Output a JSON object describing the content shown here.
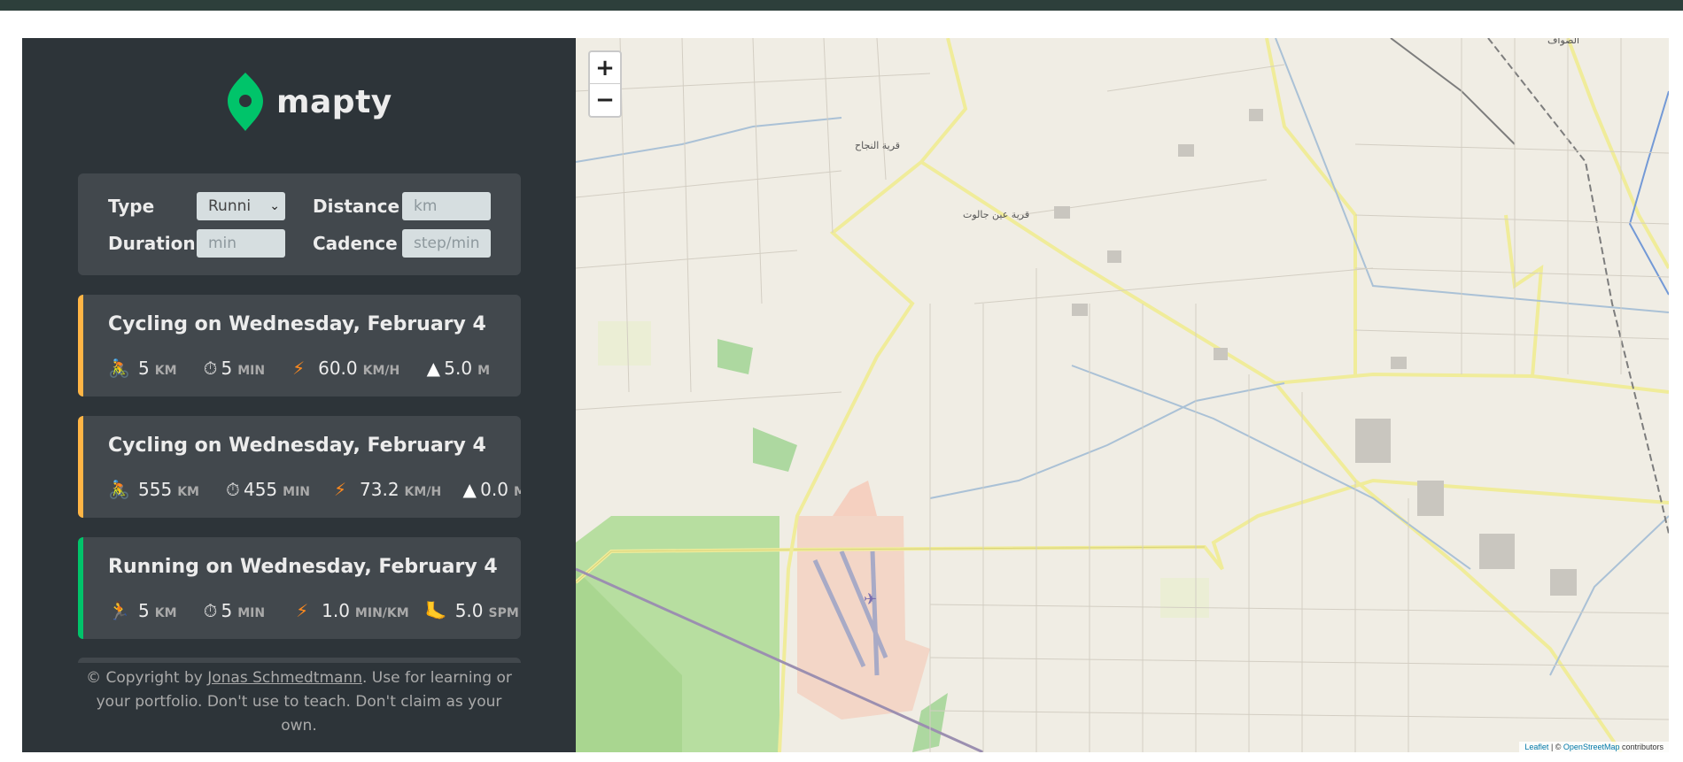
{
  "app": {
    "name": "mapty"
  },
  "form": {
    "type_label": "Type",
    "type_value": "Runni",
    "distance_label": "Distance",
    "distance_placeholder": "km",
    "duration_label": "Duration",
    "duration_placeholder": "min",
    "cadence_label": "Cadence",
    "cadence_placeholder": "step/min"
  },
  "workouts": [
    {
      "title": "Cycling on Wednesday, February 4",
      "type": "cycling",
      "accent": "#ffb545",
      "stats": [
        {
          "icon": "cyclist-icon",
          "value": "5",
          "unit": "km"
        },
        {
          "icon": "stopwatch-icon",
          "value": "5",
          "unit": "min"
        },
        {
          "icon": "lightning-icon",
          "value": "60.0",
          "unit": "km/h"
        },
        {
          "icon": "mountain-icon",
          "value": "5.0",
          "unit": "m"
        }
      ]
    },
    {
      "title": "Cycling on Wednesday, February 4",
      "type": "cycling",
      "accent": "#ffb545",
      "stats": [
        {
          "icon": "cyclist-icon",
          "value": "555",
          "unit": "km"
        },
        {
          "icon": "stopwatch-icon",
          "value": "455",
          "unit": "min"
        },
        {
          "icon": "lightning-icon",
          "value": "73.2",
          "unit": "km/h"
        },
        {
          "icon": "mountain-icon",
          "value": "0.0",
          "unit": "m"
        }
      ]
    },
    {
      "title": "Running on Wednesday, February 4",
      "type": "running",
      "accent": "#00c46a",
      "stats": [
        {
          "icon": "runner-icon",
          "value": "5",
          "unit": "km"
        },
        {
          "icon": "stopwatch-icon",
          "value": "5",
          "unit": "min"
        },
        {
          "icon": "lightning-icon",
          "value": "1.0",
          "unit": "min/km"
        },
        {
          "icon": "footprint-icon",
          "value": "5.0",
          "unit": "spm"
        }
      ]
    }
  ],
  "footer": {
    "prefix": "© Copyright by ",
    "author": "Jonas Schmedtmann",
    "suffix": ". Use for learning or your portfolio. Don't use to teach. Don't claim as your own."
  },
  "map": {
    "zoom_in": "+",
    "zoom_out": "−",
    "attribution_leaflet": "Leaflet",
    "attribution_sep": " | © ",
    "attribution_osm": "OpenStreetMap",
    "attribution_suffix": " contributors",
    "labels": {
      "village_najah": "قرية النجاح",
      "village_ain_jalut": "قرية عين جالوت",
      "town_top": "الصواف"
    }
  },
  "colors": {
    "sidebar": "#2d3439",
    "card": "#42484d",
    "cycling_accent": "#ffb545",
    "running_accent": "#00c46a",
    "logo_green": "#00c46a"
  }
}
